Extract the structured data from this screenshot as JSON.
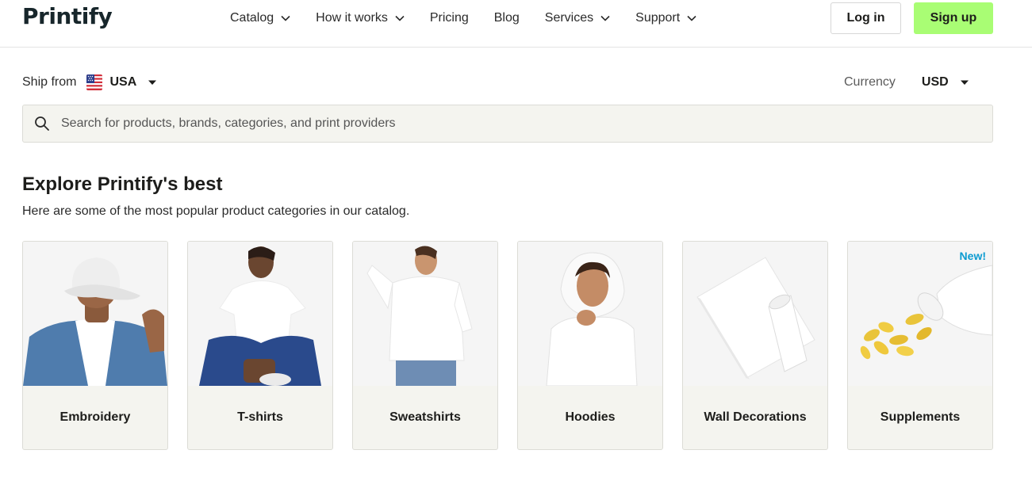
{
  "brand": {
    "logo_text": "Printify"
  },
  "nav": {
    "items": [
      {
        "label": "Catalog",
        "has_dropdown": true
      },
      {
        "label": "How it works",
        "has_dropdown": true
      },
      {
        "label": "Pricing",
        "has_dropdown": false
      },
      {
        "label": "Blog",
        "has_dropdown": false
      },
      {
        "label": "Services",
        "has_dropdown": true
      },
      {
        "label": "Support",
        "has_dropdown": true
      }
    ],
    "login_label": "Log in",
    "signup_label": "Sign up"
  },
  "shipping": {
    "label": "Ship from",
    "country": "USA",
    "flag_icon": "us-flag-icon"
  },
  "currency": {
    "label": "Currency",
    "value": "USD"
  },
  "search": {
    "placeholder": "Search for products, brands, categories, and print providers",
    "value": ""
  },
  "section": {
    "title": "Explore Printify's best",
    "subtitle": "Here are some of the most popular product categories in our catalog."
  },
  "categories": [
    {
      "label": "Embroidery"
    },
    {
      "label": "T-shirts"
    },
    {
      "label": "Sweatshirts"
    },
    {
      "label": "Hoodies"
    },
    {
      "label": "Wall Decorations"
    },
    {
      "label": "Supplements",
      "badge": "New!"
    }
  ],
  "colors": {
    "accent_green": "#a9fd74",
    "badge_blue": "#0b9bd1",
    "card_bg": "#f4f4ef",
    "text_dark": "#1d1d1b"
  }
}
